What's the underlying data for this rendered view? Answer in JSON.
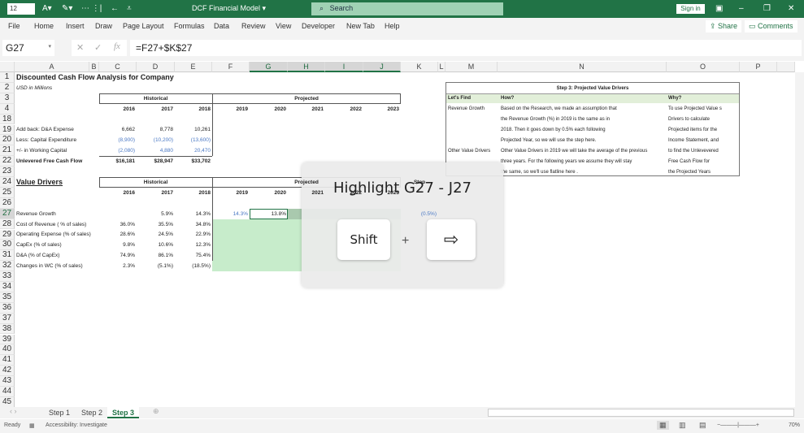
{
  "titlebar": {
    "font_size": "12",
    "doc_title": "DCF Financial Model ▾",
    "search_placeholder": "Search",
    "sign_in": "Sign in"
  },
  "menu": [
    "File",
    "Home",
    "Insert",
    "Draw",
    "Page Layout",
    "Formulas",
    "Data",
    "Review",
    "View",
    "Developer",
    "New Tab",
    "Help"
  ],
  "share": "Share",
  "comments": "Comments",
  "name_box": "G27",
  "formula": "=F27+$K$27",
  "columns": [
    "A",
    "B",
    "C",
    "D",
    "E",
    "F",
    "G",
    "H",
    "I",
    "J",
    "K",
    "L",
    "M",
    "N",
    "O",
    "P"
  ],
  "rows": [
    {
      "n": "1",
      "cells": {
        "A": "Discounted Cash Flow Analysis for Company"
      }
    },
    {
      "n": "2",
      "cells": {
        "A": "USD in Millions"
      }
    },
    {
      "n": "3",
      "cells": {
        "D": "Historical",
        "H": "Projected"
      }
    },
    {
      "n": "4",
      "cells": {
        "C": "2016",
        "D": "2017",
        "E": "2018",
        "F": "2019",
        "G": "2020",
        "H": "2021",
        "I": "2022",
        "J": "2023"
      }
    },
    {
      "n": "18",
      "cells": {}
    },
    {
      "n": "19",
      "cells": {
        "A": "Add back: D&A Expense",
        "C": "6,662",
        "D": "8,778",
        "E": "10,261"
      }
    },
    {
      "n": "20",
      "cells": {
        "A": "Less: Capital Expenditure",
        "C": "(8,900)",
        "D": "(10,200)",
        "E": "(13,600)"
      }
    },
    {
      "n": "21",
      "cells": {
        "A": "+/- in Working Capital",
        "C": "(2,080)",
        "D": "4,880",
        "E": "20,470"
      }
    },
    {
      "n": "22",
      "cells": {
        "A": "Unlevered Free Cash Flow",
        "C": "$16,181",
        "D": "$28,947",
        "E": "$33,702"
      }
    },
    {
      "n": "23",
      "cells": {}
    },
    {
      "n": "24",
      "cells": {
        "A": "Value Drivers",
        "D": "Historical",
        "H": "Projected",
        "K": "Step"
      }
    },
    {
      "n": "25",
      "cells": {
        "C": "2016",
        "D": "2017",
        "E": "2018",
        "F": "2019",
        "G": "2020",
        "H": "2021",
        "I": "2022",
        "J": "2023"
      }
    },
    {
      "n": "26",
      "cells": {}
    },
    {
      "n": "27",
      "cells": {
        "A": "Revenue Growth",
        "D": "5.9%",
        "E": "14.3%",
        "F": "14.3%",
        "G": "13.8%",
        "K": "(0.5%)"
      }
    },
    {
      "n": "28",
      "cells": {
        "A": "Cost of Revenue ( % of sales)",
        "C": "36.0%",
        "D": "35.5%",
        "E": "34.8%"
      }
    },
    {
      "n": "29",
      "cells": {
        "A": "Operating Expense (% of sales)",
        "C": "28.6%",
        "D": "24.5%",
        "E": "22.9%"
      }
    },
    {
      "n": "30",
      "cells": {
        "A": "CapEx (% of sales)",
        "C": "9.8%",
        "D": "10.6%",
        "E": "12.3%"
      }
    },
    {
      "n": "31",
      "cells": {
        "A": "D&A (% of CapEx)",
        "C": "74.9%",
        "D": "86.1%",
        "E": "75.4%"
      }
    },
    {
      "n": "32",
      "cells": {
        "A": "Changes in WC (% of sales)",
        "C": "2.3%",
        "D": "(5.1%)",
        "E": "(18.5%)"
      }
    },
    {
      "n": "33",
      "cells": {}
    },
    {
      "n": "34",
      "cells": {}
    },
    {
      "n": "35",
      "cells": {}
    },
    {
      "n": "36",
      "cells": {}
    },
    {
      "n": "37",
      "cells": {}
    },
    {
      "n": "38",
      "cells": {}
    },
    {
      "n": "39",
      "cells": {}
    },
    {
      "n": "40",
      "cells": {}
    },
    {
      "n": "41",
      "cells": {}
    },
    {
      "n": "42",
      "cells": {}
    },
    {
      "n": "43",
      "cells": {}
    },
    {
      "n": "44",
      "cells": {}
    },
    {
      "n": "45",
      "cells": {}
    }
  ],
  "step3": {
    "title": "Step 3: Projected Value Drivers",
    "headers": [
      "Let's Find",
      "How?",
      "Why?"
    ],
    "find": [
      "Revenue Growth",
      "Other Value Drivers"
    ],
    "how": [
      "Based on the Research, we made an assumption that",
      "the Revenue Growth (%) in 2019 is the same as in",
      "2018. Then it goes down by 0.5% each following",
      "Projected Year, so we will use the step here.",
      "Other Value Drivers in 2019 we will take the average of the previous",
      "three years. For the  following years we assume they will stay",
      "the same, so we'll use flatline here ."
    ],
    "why": [
      "To use Projected Value s",
      "Drivers to calculate",
      "Projected items for the",
      "Income Statement, and",
      "to find the Unlevevered",
      "Free Cash Flow for",
      "the Projected Years"
    ]
  },
  "overlay": {
    "title": "Highlight G27 - J27",
    "key1": "Shift",
    "plus": "+",
    "key2": "⇨"
  },
  "sheets": [
    "Step 1",
    "Step 2",
    "Step 3"
  ],
  "status": {
    "ready": "Ready",
    "accessibility": "Accessibility: Investigate",
    "zoom": "70%"
  }
}
